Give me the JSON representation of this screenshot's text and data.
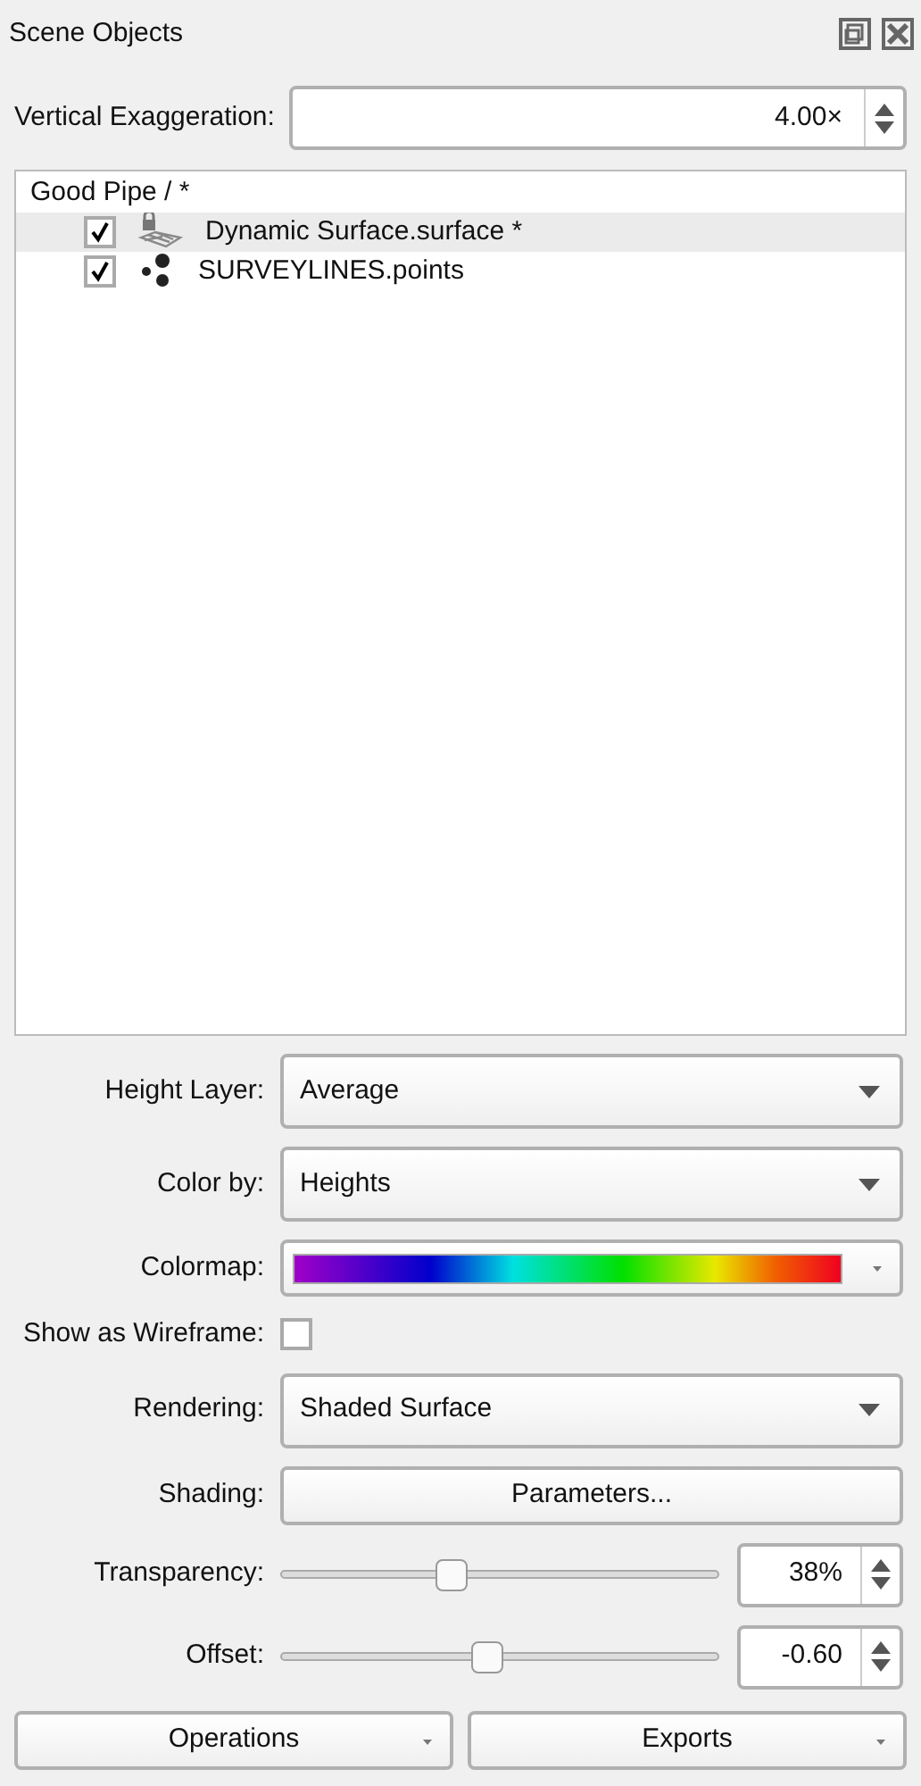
{
  "panel": {
    "title": "Scene Objects"
  },
  "exaggeration": {
    "label": "Vertical Exaggeration:",
    "value": "4.00×"
  },
  "tree": {
    "root": "Good Pipe / *",
    "children": [
      {
        "label": "Dynamic Surface.surface *",
        "checked": true,
        "selected": true,
        "kind": "surface"
      },
      {
        "label": "SURVEYLINES.points",
        "checked": true,
        "selected": false,
        "kind": "points"
      }
    ]
  },
  "fields": [
    {
      "kind": "dropdown",
      "label": "Height Layer:",
      "value": "Average"
    },
    {
      "kind": "dropdown",
      "label": "Color by:",
      "value": "Heights"
    },
    {
      "kind": "colormap",
      "label": "Colormap:"
    },
    {
      "kind": "checkbox",
      "label": "Show as Wireframe:",
      "checked": false
    },
    {
      "kind": "dropdown",
      "label": "Rendering:",
      "value": "Shaded Surface"
    },
    {
      "kind": "button",
      "label": "Shading:",
      "value": "Parameters..."
    },
    {
      "kind": "slider",
      "label": "Transparency:",
      "level": 0.39,
      "value": "38%"
    },
    {
      "kind": "slider",
      "label": "Offset:",
      "level": 0.47,
      "value": "-0.60"
    }
  ],
  "buttons": [
    "Operations",
    "Exports"
  ]
}
